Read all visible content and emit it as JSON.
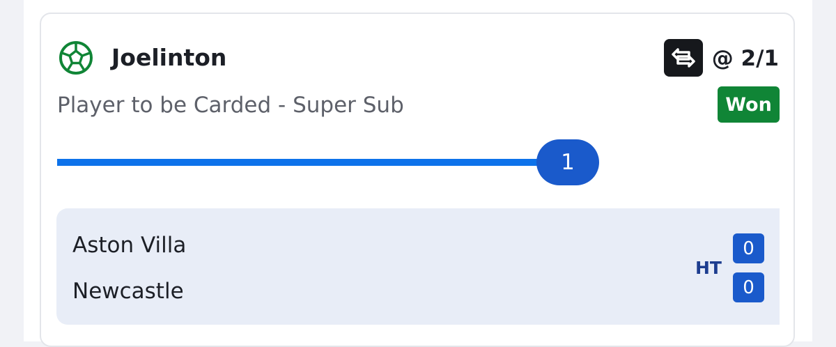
{
  "selection": {
    "icon": "football-icon",
    "player": "Joelinton",
    "market": "Player to be Carded - Super Sub",
    "odds": "@ 2/1",
    "status": "Won",
    "swap_icon": "swap-icon"
  },
  "progress": {
    "value": "1",
    "fraction": 1.0
  },
  "match": {
    "home_team": "Aston Villa",
    "away_team": "Newcastle",
    "period": "HT",
    "home_score": "0",
    "away_score": "0"
  },
  "colors": {
    "brand_green": "#108536",
    "accent_blue": "#1a5acb",
    "progress_blue": "#0d72ea",
    "scoreboard_bg": "#e8edf7"
  }
}
